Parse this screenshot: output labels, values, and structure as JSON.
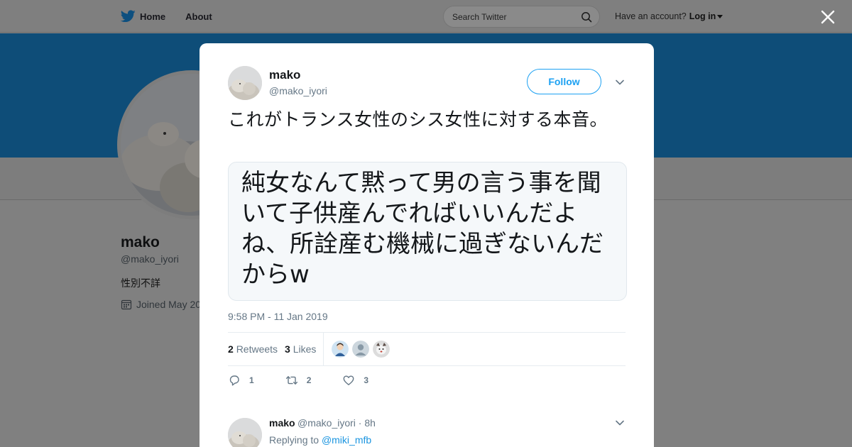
{
  "nav": {
    "home_label": "Home",
    "about_label": "About",
    "search_placeholder": "Search Twitter",
    "account_prompt": "Have an account?",
    "login_label": "Log in"
  },
  "profile": {
    "name": "mako",
    "handle": "@mako_iyori",
    "bio": "性別不詳",
    "joined": "Joined May 20"
  },
  "tweet": {
    "author_name": "mako",
    "author_handle": "@mako_iyori",
    "follow_label": "Follow",
    "text": "これがトランス女性のシス女性に対する本音。",
    "quote_text": "純女なんて黙って男の言う事を聞いて子供産んでればいいんだよね、所詮産む機械に過ぎないんだからw",
    "timestamp": "9:58 PM - 11 Jan 2019",
    "retweets_count": "2",
    "retweets_label": "Retweets",
    "likes_count": "3",
    "likes_label": "Likes",
    "reply_count": "1",
    "retweet_action_count": "2",
    "like_action_count": "3"
  },
  "reply": {
    "name": "mako",
    "handle_time": "@mako_iyori · 8h",
    "replying_prefix": "Replying to",
    "replying_to": "@miki_mfb"
  },
  "colors": {
    "accent": "#1da1f2",
    "banner": "#0e4d78",
    "overlay": "#808080",
    "text_secondary": "#657786"
  },
  "icons": [
    "twitter-bird-icon",
    "home-icon",
    "search-icon",
    "caret-down-icon",
    "close-icon",
    "calendar-icon",
    "chevron-down-icon",
    "reply-icon",
    "retweet-icon",
    "heart-icon"
  ]
}
